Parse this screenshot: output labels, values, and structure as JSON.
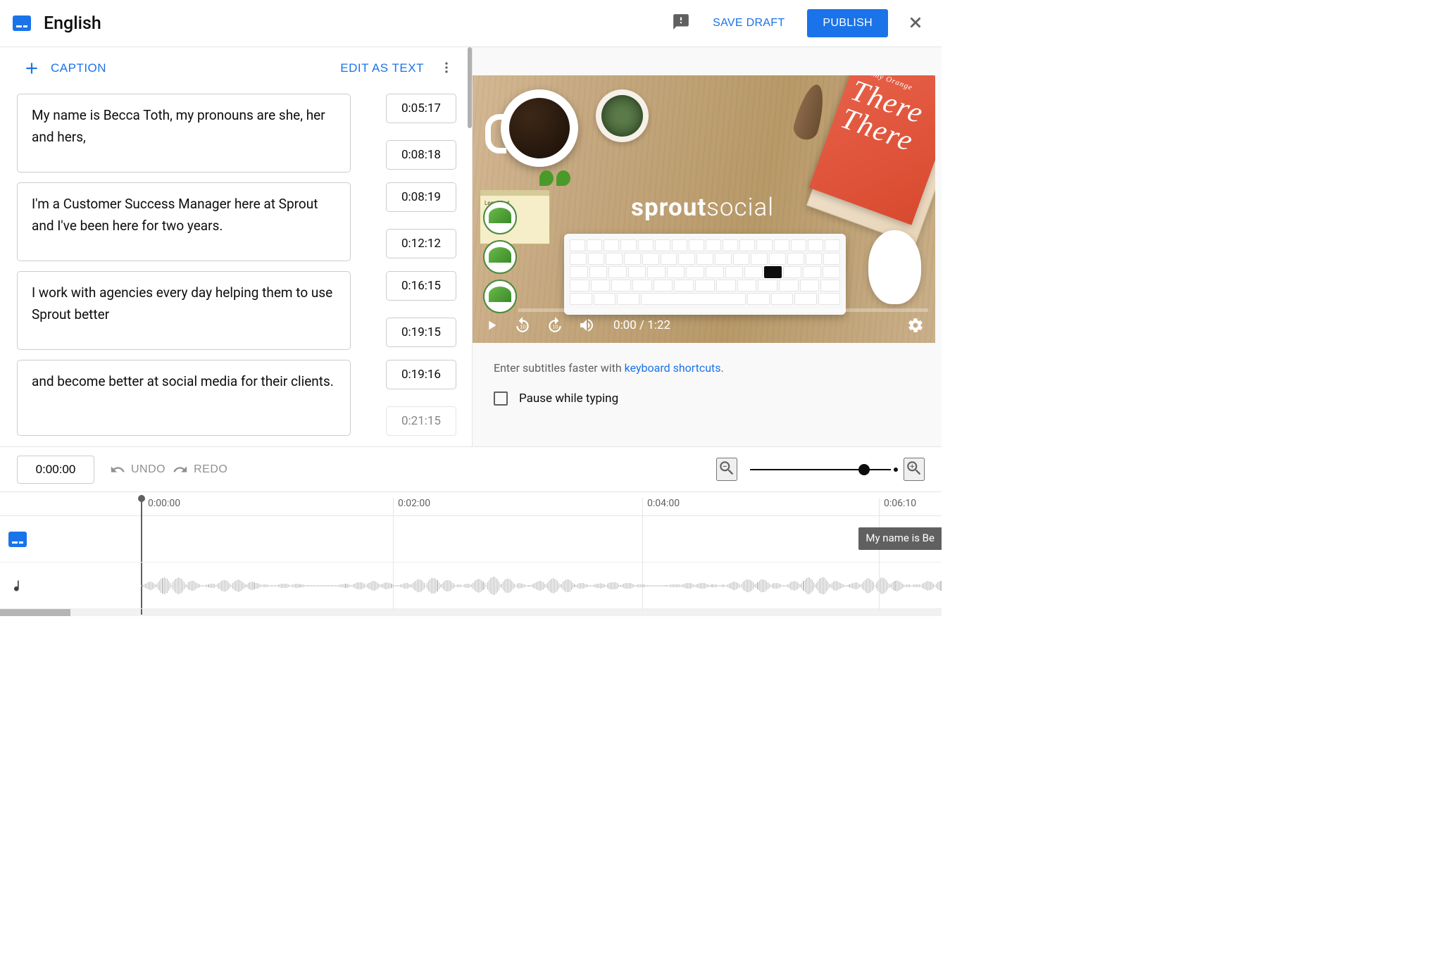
{
  "header": {
    "title": "English",
    "save_draft": "SAVE DRAFT",
    "publish": "PUBLISH"
  },
  "caption_panel": {
    "add_caption": "CAPTION",
    "edit_as_text": "EDIT AS TEXT"
  },
  "captions": [
    {
      "text": "My name is Becca Toth, my pronouns are she, her and hers,",
      "start": "0:05:17",
      "end": "0:08:18"
    },
    {
      "text": "I'm a Customer Success Manager here at Sprout\nand I've been here for two years.",
      "start": "0:08:19",
      "end": "0:12:12"
    },
    {
      "text": "I work with agencies every day helping them to use Sprout better",
      "start": "0:16:15",
      "end": "0:19:15"
    },
    {
      "text": "and become better at social media for their clients.",
      "start": "0:19:16",
      "end": "0:21:15"
    }
  ],
  "video": {
    "brand_bold": "sprout",
    "brand_light": "social",
    "book_title1": "There",
    "book_title2": "There",
    "book_author": "Tommy Orange",
    "current_time": "0:00",
    "total_time": "1:22",
    "time_display": "0:00 / 1:22",
    "legal_pad": "Legal Pad"
  },
  "hints": {
    "prefix": "Enter subtitles faster with ",
    "link": "keyboard shortcuts",
    "suffix": ".",
    "pause_typing": "Pause while typing"
  },
  "timeline_toolbar": {
    "current_time": "0:00:00",
    "undo": "UNDO",
    "redo": "REDO"
  },
  "timeline_ruler": {
    "t0": "0:00:00",
    "t1": "0:02:00",
    "t2": "0:04:00",
    "t3": "0:06:10"
  },
  "timeline_clip": "My name is Be"
}
